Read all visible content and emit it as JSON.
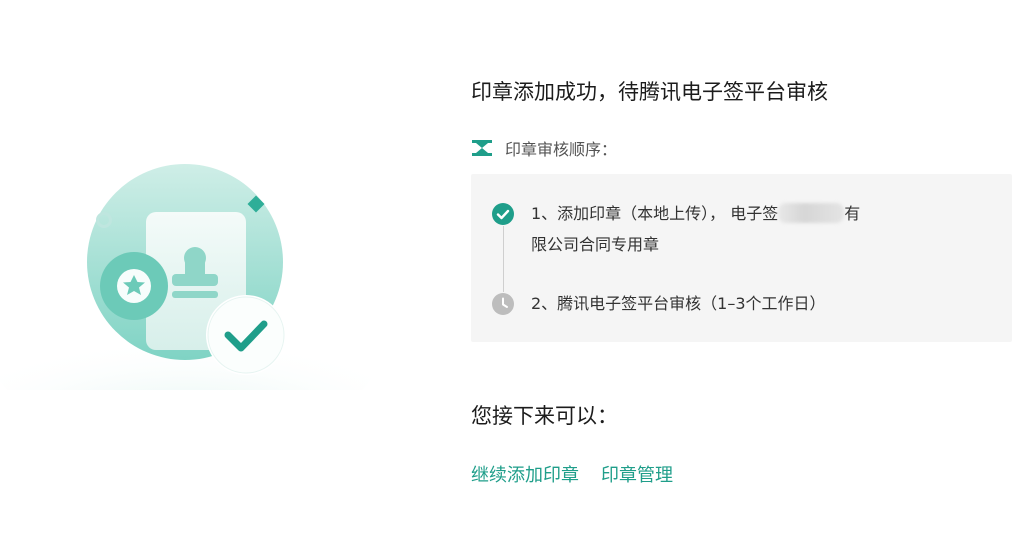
{
  "header": {
    "title": "印章添加成功，待腾讯电子签平台审核"
  },
  "review": {
    "label": "印章审核顺序：",
    "steps": [
      {
        "text_line1_prefix": "1、添加印章（本地上传）， 电子签",
        "text_line1_suffix": "有",
        "text_line2": "限公司合同专用章",
        "status": "done",
        "icon": "check-circle-icon"
      },
      {
        "text": "2、腾讯电子签平台审核（1–3个工作日）",
        "status": "pending",
        "icon": "clock-icon"
      }
    ]
  },
  "next": {
    "title": "您接下来可以：",
    "links": {
      "continue_add": "继续添加印章",
      "manage": "印章管理"
    }
  },
  "colors": {
    "accent": "#1f9e8a",
    "pending": "#bdbdbd",
    "box": "#f5f5f5"
  }
}
